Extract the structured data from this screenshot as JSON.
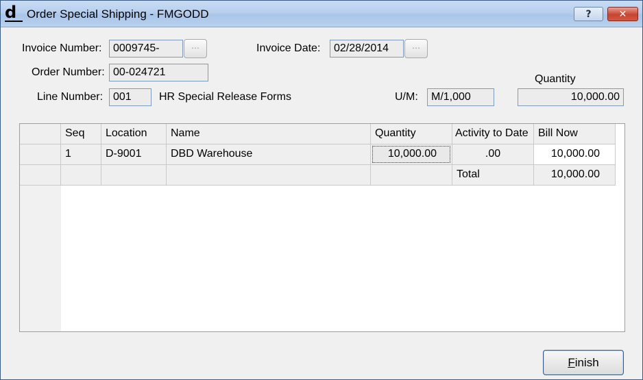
{
  "window": {
    "title": "Order Special Shipping - FMGODD",
    "app_icon_glyph": "d",
    "help_glyph": "?",
    "close_glyph": "✕"
  },
  "form": {
    "invoice_number_label": "Invoice Number:",
    "invoice_number_value": "0009745-",
    "invoice_date_label": "Invoice Date:",
    "invoice_date_value": "02/28/2014",
    "order_number_label": "Order Number:",
    "order_number_value": "00-024721",
    "line_number_label": "Line Number:",
    "line_number_value": "001",
    "line_description": "HR Special Release Forms",
    "um_label": "U/M:",
    "um_value": "M/1,000",
    "quantity_label": "Quantity",
    "quantity_value": "10,000.00",
    "lookup_glyph": "⋯"
  },
  "grid": {
    "columns": [
      "Seq",
      "Location",
      "Name",
      "Quantity",
      "Activity to Date",
      "Bill Now"
    ],
    "rows": [
      {
        "seq": "1",
        "location": "D-9001",
        "name": "DBD Warehouse",
        "quantity": "10,000.00",
        "activity": ".00",
        "bill_now": "10,000.00"
      }
    ],
    "total_label": "Total",
    "total_value": "10,000.00"
  },
  "buttons": {
    "finish_accel": "F",
    "finish_rest": "inish"
  }
}
